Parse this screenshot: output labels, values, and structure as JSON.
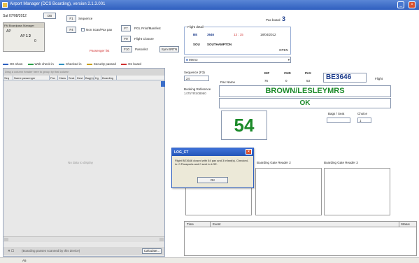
{
  "window": {
    "title": "Airport Manager (DCS Boarding), version 2.1.3.001"
  },
  "top": {
    "date": "Sat 07/08/2012",
    "date_button": "DB",
    "f1_button": "F1",
    "f1_label": "Sequence",
    "f4_button": "F4",
    "checkbox_label": "Non Scan/Pax pax",
    "f7_button": "F7",
    "f7_label": "PGL Print/Manifest",
    "f9_button": "F9",
    "f9_label": "Flight Closure",
    "f10_button": "F10",
    "f10_label": "Passolist",
    "sym_button": "Sym BRTN",
    "pax_count_label": "Pax board",
    "pax_count_value": "3",
    "passenger_list_label": "Passenger list"
  },
  "manager": {
    "title": "FM Boardpass Manager",
    "rows": [
      {
        "a": "AP",
        "b": ""
      },
      {
        "a": "",
        "b": ""
      },
      {
        "a": "AP",
        "b": "1  2"
      },
      {
        "a": "",
        "b": "0"
      }
    ]
  },
  "flight": {
    "header": "Flight detail",
    "airline": "BE",
    "flight_no": "3646",
    "time": "13 : 15",
    "flight_date": "18/04/2012",
    "dest_code": "SOU",
    "dest_name": "SOUTHAMPTON",
    "status": "OPEN",
    "memo_label": "Memo"
  },
  "legend": [
    {
      "label": "OK show",
      "color": "#2c5fbf"
    },
    {
      "label": "Web check-in",
      "color": "#2ca04a"
    },
    {
      "label": "Checked in",
      "color": "#2e8fbf"
    },
    {
      "label": "Security passed",
      "color": "#c8a020"
    },
    {
      "label": "On board",
      "color": "#d03030"
    }
  ],
  "left_panel": {
    "header": "Drag a column header here to group by that column",
    "columns": [
      "Seq",
      "Name passenger",
      "Pax",
      "Class",
      "Seat",
      "Dest",
      "Bag(s)",
      "Kg",
      "Boarding"
    ],
    "empty_text": "No data to display",
    "footer_text": "(Boarding passes scanned by this device)",
    "footer_button": "Calculate..."
  },
  "boarding": {
    "sequence_label": "Sequence (F3)",
    "sequence_value": "24",
    "pax_name_label": "Pax Name",
    "booking_ref_label": "Booking Reference",
    "booking_ref_value": "1475YRS08960",
    "inf_label": "INF",
    "chd_label": "CHD",
    "pax_label": "PAX",
    "inf_value": "76",
    "chd_value": "0",
    "pax_value": "53",
    "flight_code": "BE3646",
    "flight_label": "Flight",
    "passenger_name": "BROWN/LESLEYMRS",
    "status": "OK",
    "big_number": "54",
    "bags_label": "Bags / Seat",
    "choice_label": "Choice",
    "choice_value": "1"
  },
  "readers": {
    "reader2": "Boarding Gate Reader 2",
    "reader3": "Boarding Gate Reader 3"
  },
  "log": {
    "col_time": "Time",
    "col_event": "Event",
    "col_status": "Status"
  },
  "dialog": {
    "title": "LOG_CT",
    "message": "Flight BE3646 closed with 54 pax and 3 infant(s). Checked-in: 0 Passports and 0 sent to LOE.",
    "ok": "OK"
  },
  "statusbar": {
    "text": "A5"
  },
  "colors": {
    "accent": "#2f5fbf",
    "green": "#1c8a2a"
  }
}
